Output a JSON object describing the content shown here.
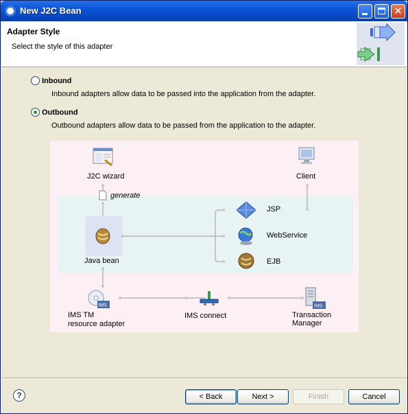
{
  "window": {
    "title": "New J2C Bean"
  },
  "header": {
    "title": "Adapter Style",
    "description": "Select the style of this adapter"
  },
  "options": [
    {
      "label": "Inbound",
      "description": "Inbound adapters allow data to be passed into the application from the adapter.",
      "selected": false
    },
    {
      "label": "Outbound",
      "description": "Outbound adapters allow data to be passed from the application to the adapter.",
      "selected": true
    }
  ],
  "diagram": {
    "j2c_wizard": "J2C wizard",
    "client": "Client",
    "generate": "generate",
    "java_bean": "Java bean",
    "jsp": "JSP",
    "webservice": "WebService",
    "ejb": "EJB",
    "ims_tm": "IMS TM",
    "resource_adapter": "resource adapter",
    "ims_connect": "IMS connect",
    "transaction": "Transaction",
    "manager": "Manager"
  },
  "buttons": {
    "back": "< Back",
    "next": "Next >",
    "finish": "Finish",
    "cancel": "Cancel"
  }
}
